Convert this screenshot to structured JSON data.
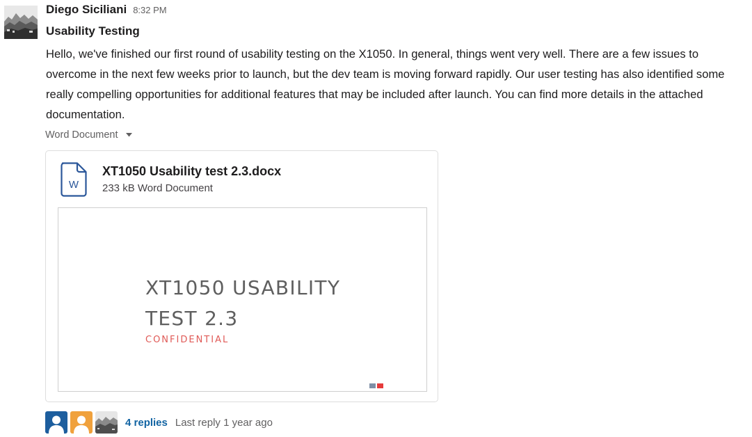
{
  "message": {
    "sender": "Diego Siciliani",
    "timestamp": "8:32 PM",
    "subject": "Usability Testing",
    "body": "Hello, we've finished our first round of usability testing on the X1050. In general, things went very well. There are a few issues to overcome in the next few weeks prior to launch, but the dev team is moving forward rapidly. Our user testing has also identified some really compelling opportunities for additional features that may be included after launch. You can find more details in the attached documentation."
  },
  "attachment": {
    "type_label": "Word Document",
    "file_name": "XT1050 Usability test 2.3.docx",
    "meta": "233 kB Word Document",
    "icon_letter": "W",
    "preview": {
      "title": "XT1050 USABILITY\nTEST 2.3",
      "subtitle": "CONFIDENTIAL"
    }
  },
  "thread": {
    "replies_label": "4 replies",
    "last_reply": "Last reply 1 year ago"
  },
  "icons": {
    "caret": "caret-down-icon",
    "document": "word-document-icon",
    "avatar_blue": "user-avatar-icon",
    "avatar_orange": "user-avatar-icon"
  },
  "colors": {
    "link": "#1264a3",
    "doc_icon": "#2b579a",
    "confidential": "#e05a57",
    "avatar_blue": "#1d5e9e",
    "avatar_orange": "#f0a13c"
  }
}
